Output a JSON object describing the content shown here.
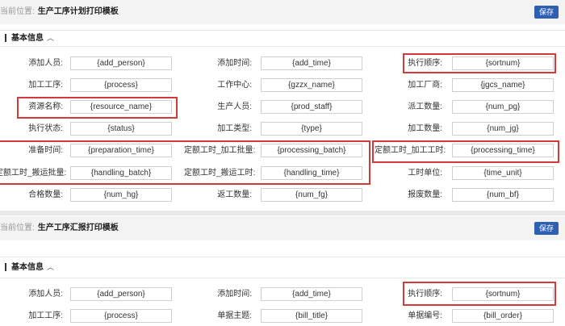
{
  "section1": {
    "breadcrumb_prefix": "当前位置:",
    "page_title": "生产工序计划打印模板",
    "save_label": "保存",
    "group_title": "基本信息",
    "rows": [
      [
        {
          "label": "添加人员:",
          "value": "{add_person}"
        },
        {
          "label": "添加时间:",
          "value": "{add_time}"
        },
        {
          "label": "执行顺序:",
          "value": "{sortnum}"
        }
      ],
      [
        {
          "label": "加工工序:",
          "value": "{process}"
        },
        {
          "label": "工作中心:",
          "value": "{gzzx_name}"
        },
        {
          "label": "加工厂商:",
          "value": "{jgcs_name}"
        }
      ],
      [
        {
          "label": "资源名称:",
          "value": "{resource_name}"
        },
        {
          "label": "生产人员:",
          "value": "{prod_staff}"
        },
        {
          "label": "派工数量:",
          "value": "{num_pg}"
        }
      ],
      [
        {
          "label": "执行状态:",
          "value": "{status}"
        },
        {
          "label": "加工类型:",
          "value": "{type}"
        },
        {
          "label": "加工数量:",
          "value": "{num_jg}"
        }
      ],
      [
        {
          "label": "准备时间:",
          "value": "{preparation_time}"
        },
        {
          "label": "定额工时_加工批量:",
          "value": "{processing_batch}"
        },
        {
          "label": "定额工时_加工工时:",
          "value": "{processing_time}"
        }
      ],
      [
        {
          "label": "定额工时_搬运批量:",
          "value": "{handling_batch}"
        },
        {
          "label": "定额工时_搬运工时:",
          "value": "{handling_time}"
        },
        {
          "label": "工时单位:",
          "value": "{time_unit}"
        }
      ],
      [
        {
          "label": "合格数量:",
          "value": "{num_hg}"
        },
        {
          "label": "返工数量:",
          "value": "{num_fg}"
        },
        {
          "label": "报废数量:",
          "value": "{num_bf}"
        }
      ]
    ]
  },
  "section2": {
    "breadcrumb_prefix": "当前位置:",
    "page_title": "生产工序汇报打印模板",
    "save_label": "保存",
    "group_title": "基本信息",
    "rows": [
      [
        {
          "label": "添加人员:",
          "value": "{add_person}"
        },
        {
          "label": "添加时间:",
          "value": "{add_time}"
        },
        {
          "label": "执行顺序:",
          "value": "{sortnum}"
        }
      ],
      [
        {
          "label": "加工工序:",
          "value": "{process}"
        },
        {
          "label": "单据主题:",
          "value": "{bill_title}"
        },
        {
          "label": "单据编号:",
          "value": "{bill_order}"
        }
      ]
    ]
  },
  "colors": {
    "accent": "#2f5fb3",
    "highlight": "#d43a3a",
    "header_bg": "#f3f3f3"
  }
}
